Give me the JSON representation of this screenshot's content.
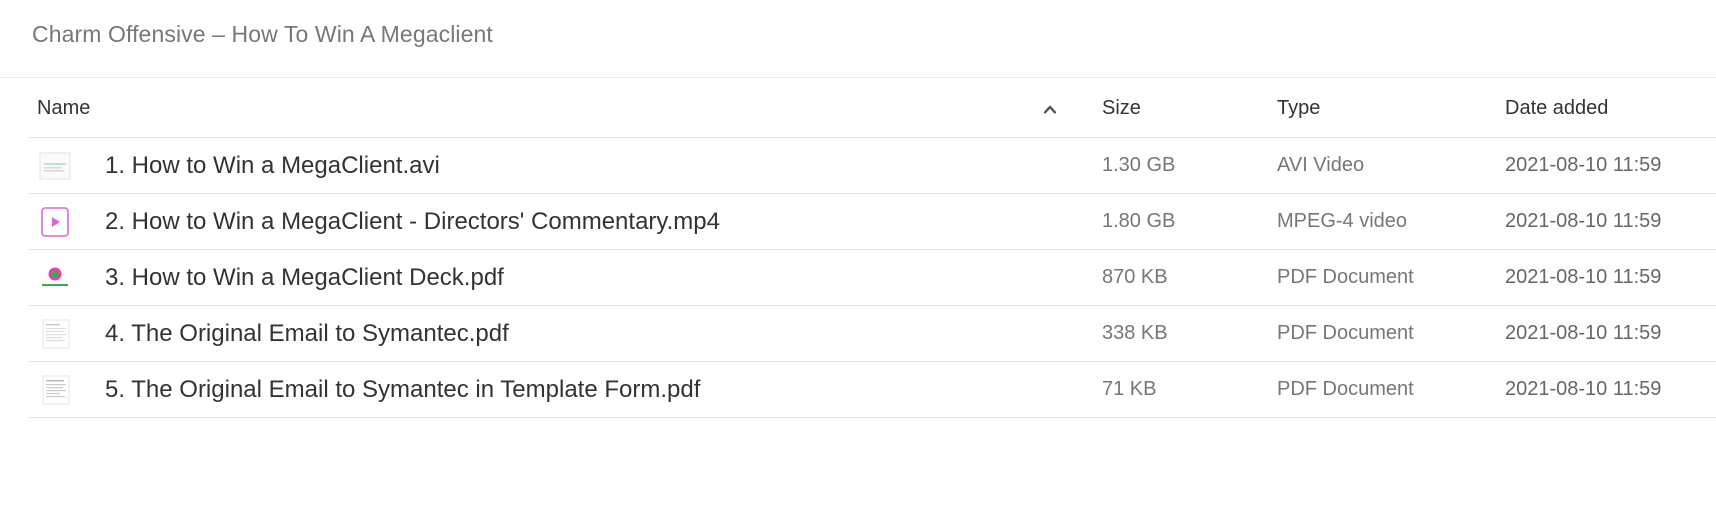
{
  "page": {
    "title": "Charm Offensive – How To Win A Megaclient"
  },
  "table": {
    "columns": {
      "name": "Name",
      "size": "Size",
      "type": "Type",
      "date": "Date added"
    },
    "sort": {
      "column": "Name",
      "direction": "ascending"
    },
    "rows": [
      {
        "name": "1. How to Win a MegaClient.avi",
        "size": "1.30 GB",
        "type": "AVI Video",
        "date": "2021-08-10 11:59",
        "icon": "video-thumbnail-icon"
      },
      {
        "name": "2. How to Win a MegaClient - Directors' Commentary.mp4",
        "size": "1.80 GB",
        "type": "MPEG-4 video",
        "date": "2021-08-10 11:59",
        "icon": "play-video-icon"
      },
      {
        "name": "3. How to Win a MegaClient Deck.pdf",
        "size": "870 KB",
        "type": "PDF Document",
        "date": "2021-08-10 11:59",
        "icon": "pdf-deck-thumbnail-icon"
      },
      {
        "name": "4. The Original Email to Symantec.pdf",
        "size": "338 KB",
        "type": "PDF Document",
        "date": "2021-08-10 11:59",
        "icon": "pdf-document-thumbnail-icon"
      },
      {
        "name": "5. The Original Email to Symantec in Template Form.pdf",
        "size": "71 KB",
        "type": "PDF Document",
        "date": "2021-08-10 11:59",
        "icon": "pdf-document-thumbnail-icon"
      }
    ]
  },
  "colors": {
    "accent_play": "#d96ad4",
    "deck_green": "#29b34a",
    "deck_pink": "#e83fb0"
  }
}
